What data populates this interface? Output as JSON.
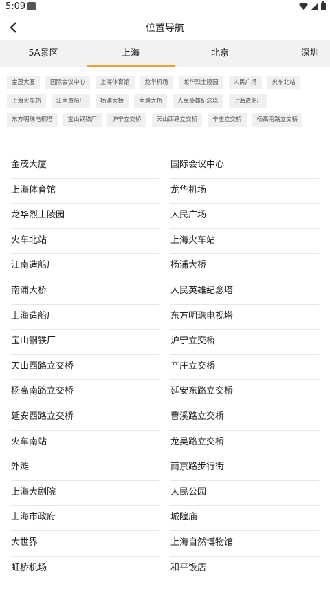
{
  "status_bar": {
    "time": "5:09"
  },
  "header": {
    "title": "位置导航"
  },
  "tabs": [
    {
      "label": "5A景区"
    },
    {
      "label": "上海"
    },
    {
      "label": "北京"
    },
    {
      "label": "深圳"
    }
  ],
  "active_tab": "上海",
  "accent_color": "#f0a030",
  "chips": [
    [
      "金茂大厦",
      "国际会议中心",
      "上海体育馆",
      "龙华机场",
      "龙华烈士陵园",
      "人民广场",
      "火车北站"
    ],
    [
      "上海火车站",
      "江南造船厂",
      "杨浦大桥",
      "南浦大桥",
      "人民英雄纪念塔",
      "上海造船厂"
    ],
    [
      "东方明珠电视塔",
      "宝山钢铁厂",
      "沪宁立交桥",
      "天山西路立交桥",
      "辛庄立交桥",
      "杨高南路立交桥"
    ]
  ],
  "list": [
    [
      "金茂大厦",
      "国际会议中心"
    ],
    [
      "上海体育馆",
      "龙华机场"
    ],
    [
      "龙华烈士陵园",
      "人民广场"
    ],
    [
      "火车北站",
      "上海火车站"
    ],
    [
      "江南造船厂",
      "杨浦大桥"
    ],
    [
      "南浦大桥",
      "人民英雄纪念塔"
    ],
    [
      "上海造船厂",
      "东方明珠电视塔"
    ],
    [
      "宝山钢铁厂",
      "沪宁立交桥"
    ],
    [
      "天山西路立交桥",
      "辛庄立交桥"
    ],
    [
      "杨高南路立交桥",
      "延安东路立交桥"
    ],
    [
      "延安西路立交桥",
      "曹溪路立交桥"
    ],
    [
      "火车南站",
      "龙吴路立交桥"
    ],
    [
      "外滩",
      "南京路步行街"
    ],
    [
      "上海大剧院",
      "人民公园"
    ],
    [
      "上海市政府",
      "城隍庙"
    ],
    [
      "大世界",
      "上海自然博物馆"
    ],
    [
      "虹桥机场",
      "和平饭店"
    ]
  ]
}
